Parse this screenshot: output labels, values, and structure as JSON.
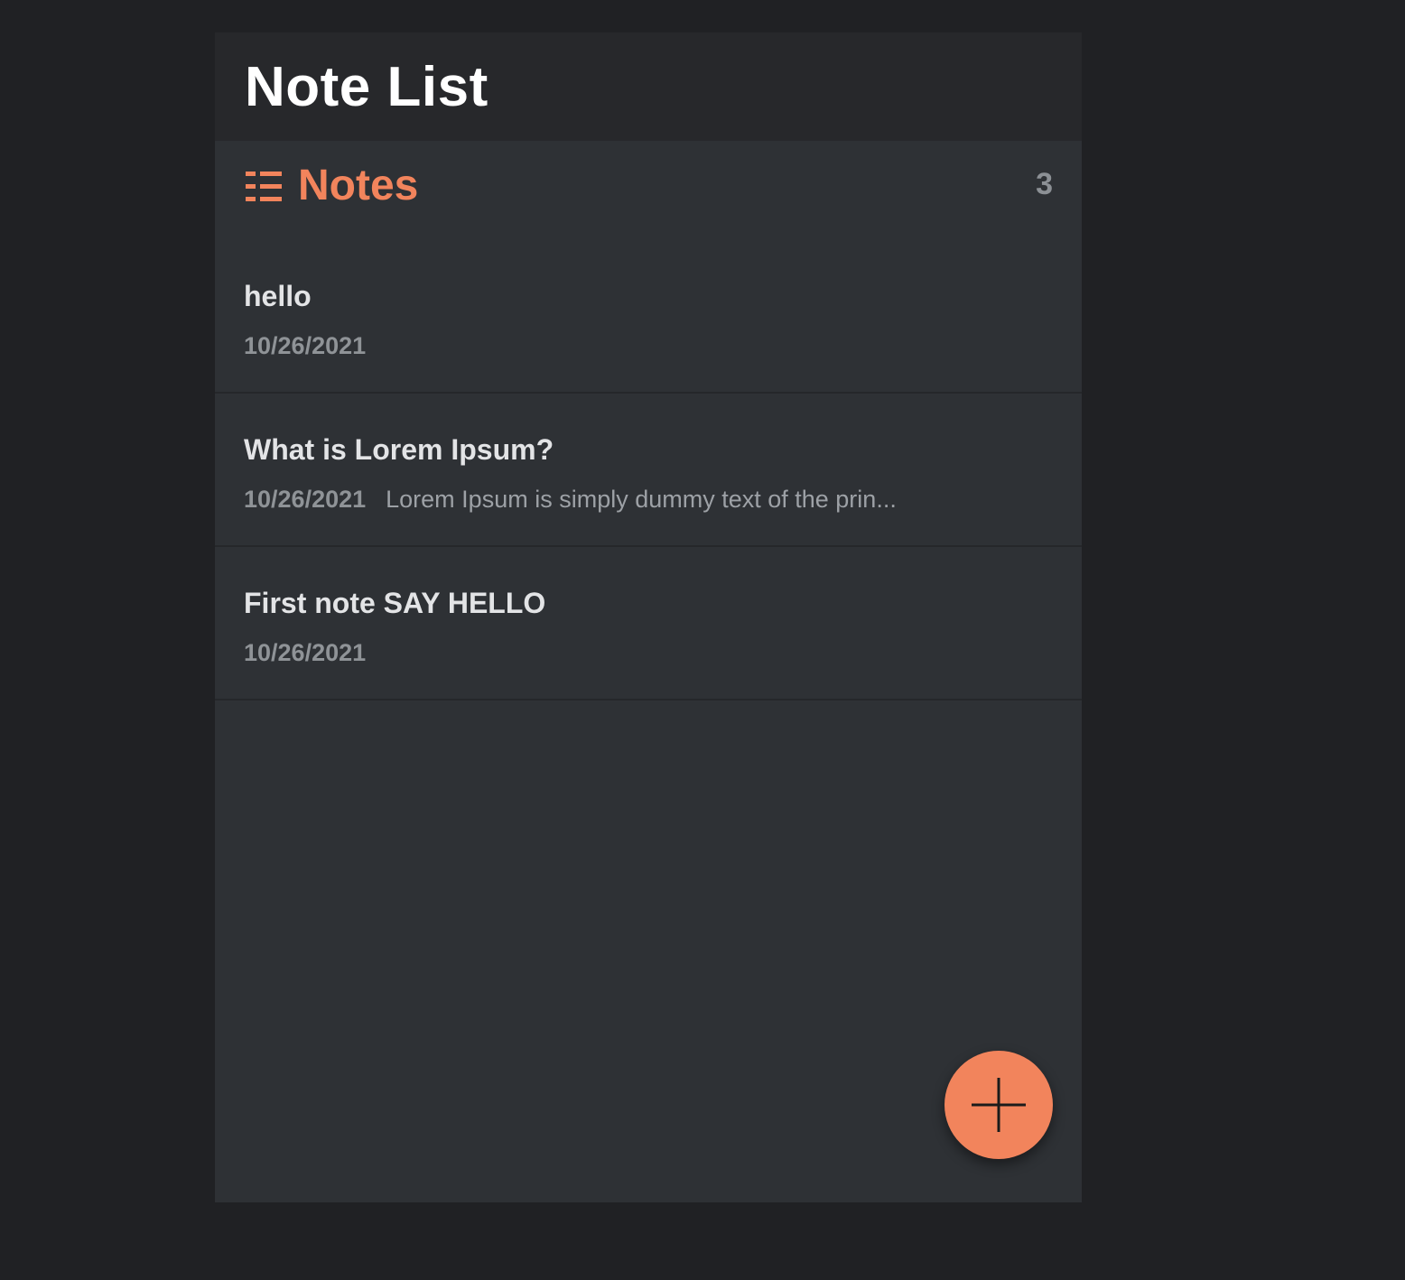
{
  "colors": {
    "accent": "#f2845c",
    "background": "#202124",
    "panel": "#2e3135",
    "header": "#27282b"
  },
  "header": {
    "title": "Note List"
  },
  "section": {
    "icon": "list-icon",
    "title": "Notes",
    "count": "3"
  },
  "notes": [
    {
      "title": "hello",
      "date": "10/26/2021",
      "preview": ""
    },
    {
      "title": "What is Lorem Ipsum?",
      "date": "10/26/2021",
      "preview": "Lorem Ipsum is simply dummy text of the prin..."
    },
    {
      "title": "First note SAY HELLO",
      "date": "10/26/2021",
      "preview": ""
    }
  ],
  "fab": {
    "icon": "plus-icon"
  }
}
